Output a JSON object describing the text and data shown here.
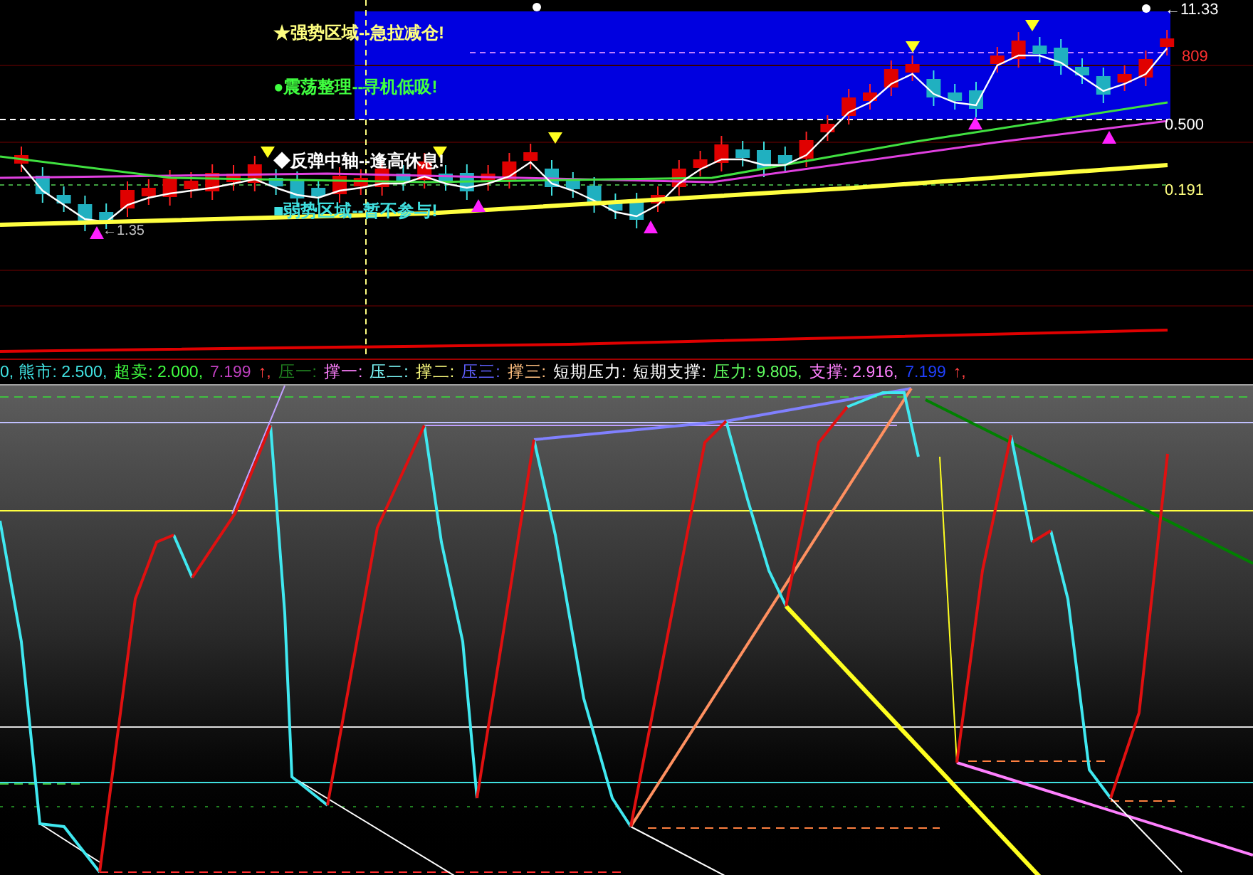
{
  "price_panel": {
    "zone_labels": [
      {
        "text": "★强势区域--急拉减仓!",
        "color": "#ffff80"
      },
      {
        "text": "●震荡整理--寻机低吸!",
        "color": "#40ff40"
      },
      {
        "text": "◆反弹中轴--逢高休息!",
        "color": "#ffffff"
      },
      {
        "text": "■弱势区域--暂不参与!",
        "color": "#40e0e0"
      }
    ],
    "axis_labels": [
      {
        "text": "←11.33",
        "color": "#ffffff"
      },
      {
        "text": "809",
        "color": "#ff3030"
      },
      {
        "text": "0.500",
        "color": "#ffffff"
      },
      {
        "text": "0.191",
        "color": "#ffff80"
      }
    ],
    "low_label": "←1.35"
  },
  "indicator_header": [
    {
      "text": "0, 熊市: 2.500,",
      "color": "#40e0e0"
    },
    {
      "text": "超卖: 2.000,",
      "color": "#40ff40"
    },
    {
      "text": "7.199",
      "color": "#c040c0"
    },
    {
      "text": "↑,",
      "color": "#ff4040"
    },
    {
      "text": "压一:",
      "color": "#208020"
    },
    {
      "text": "撑一:",
      "color": "#ff80ff"
    },
    {
      "text": "压二:",
      "color": "#80ffff"
    },
    {
      "text": "撑二:",
      "color": "#ffff80"
    },
    {
      "text": "压三:",
      "color": "#6060ff"
    },
    {
      "text": "撑三:",
      "color": "#ffc080"
    },
    {
      "text": "短期压力:",
      "color": "#ffffff"
    },
    {
      "text": "短期支撑:",
      "color": "#ffffff"
    },
    {
      "text": "压力: 9.805,",
      "color": "#60ff60"
    },
    {
      "text": "支撑: 2.916,",
      "color": "#ff80ff"
    },
    {
      "text": "7.199",
      "color": "#2040ff"
    },
    {
      "text": "↑,",
      "color": "#ff4040"
    }
  ]
}
